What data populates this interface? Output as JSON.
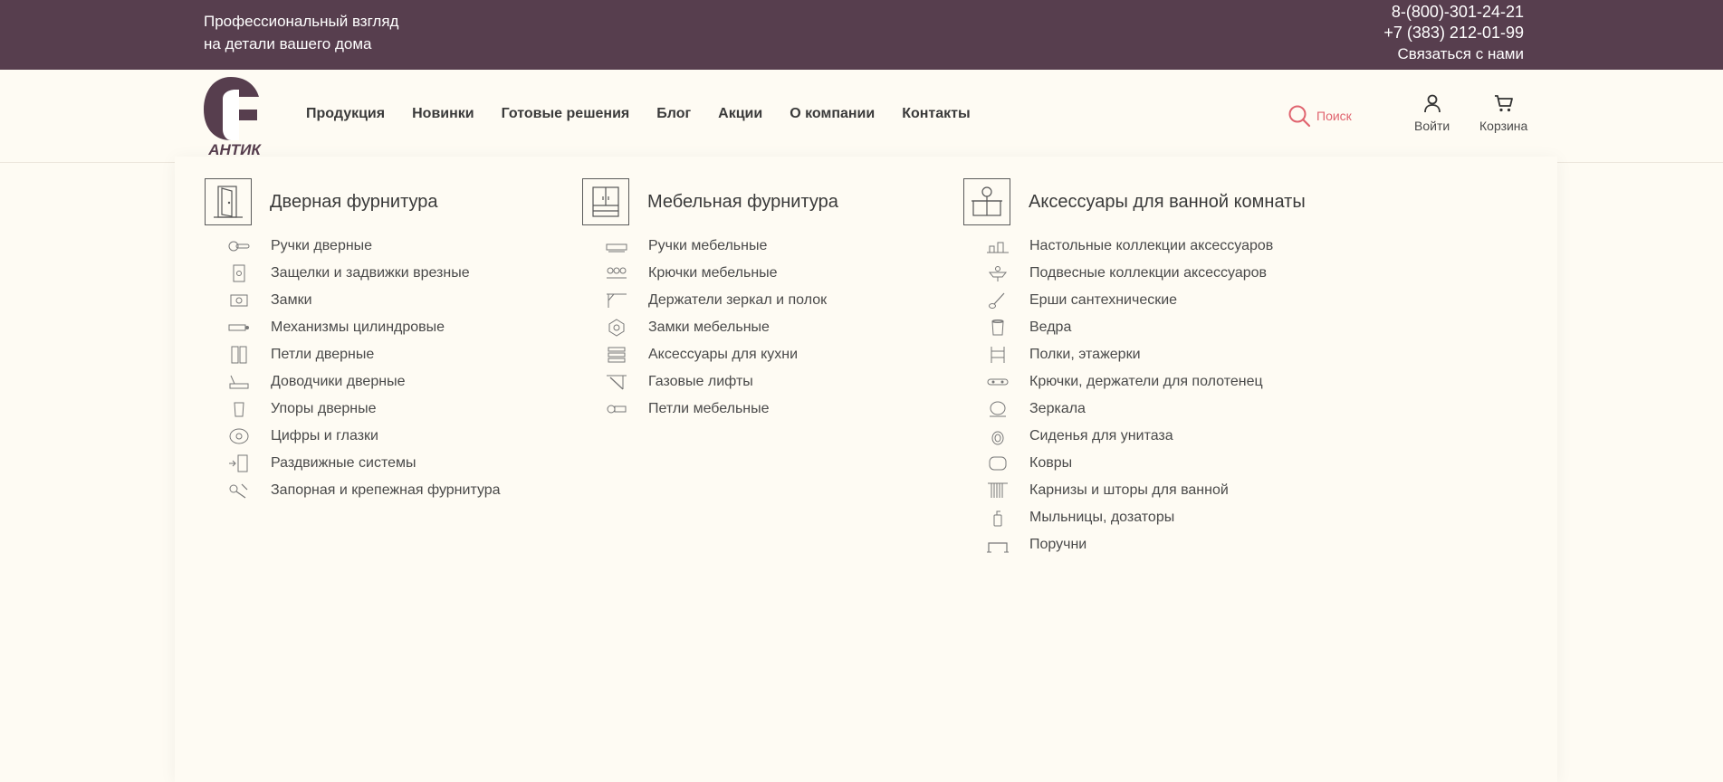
{
  "topbar": {
    "tagline_line1": "Профессиональный взгляд",
    "tagline_line2": "на детали вашего дома",
    "phone1": "8-(800)-301-24-21",
    "phone2": "+7 (383) 212-01-99",
    "contact_link": "Связаться с нами"
  },
  "logo": {
    "text": "АНТИК"
  },
  "nav": [
    "Продукция",
    "Новинки",
    "Готовые решения",
    "Блог",
    "Акции",
    "О компании",
    "Контакты"
  ],
  "search": {
    "placeholder": "Поиск"
  },
  "header_buttons": {
    "login": "Войти",
    "cart": "Корзина"
  },
  "menu": {
    "columns": [
      {
        "title": "Дверная фурнитура",
        "icon": "door-icon",
        "items": [
          "Ручки дверные",
          "Защелки и задвижки врезные",
          "Замки",
          "Механизмы цилиндровые",
          "Петли дверные",
          "Доводчики дверные",
          "Упоры дверные",
          "Цифры и глазки",
          "Раздвижные системы",
          "Запорная и крепежная фурнитура"
        ]
      },
      {
        "title": "Мебельная фурнитура",
        "icon": "cabinet-icon",
        "items": [
          "Ручки мебельные",
          "Крючки мебельные",
          "Держатели зеркал и полок",
          "Замки мебельные",
          "Аксессуары для кухни",
          "Газовые лифты",
          "Петли мебельные"
        ]
      },
      {
        "title": "Аксессуары для ванной комнаты",
        "icon": "bathroom-vanity-icon",
        "items": [
          "Настольные коллекции аксессуаров",
          "Подвесные коллекции аксессуаров",
          "Ерши сантехнические",
          "Ведра",
          "Полки, этажерки",
          "Крючки, держатели для полотенец",
          "Зеркала",
          "Сиденья для унитаза",
          "Ковры",
          "Карнизы и шторы для ванной",
          "Мыльницы, дозаторы",
          "Поручни"
        ]
      }
    ]
  },
  "colors": {
    "topbar_bg": "#573e4e",
    "page_bg": "#fefbf3",
    "brand": "#573e4e",
    "search_accent": "#e0646f"
  }
}
